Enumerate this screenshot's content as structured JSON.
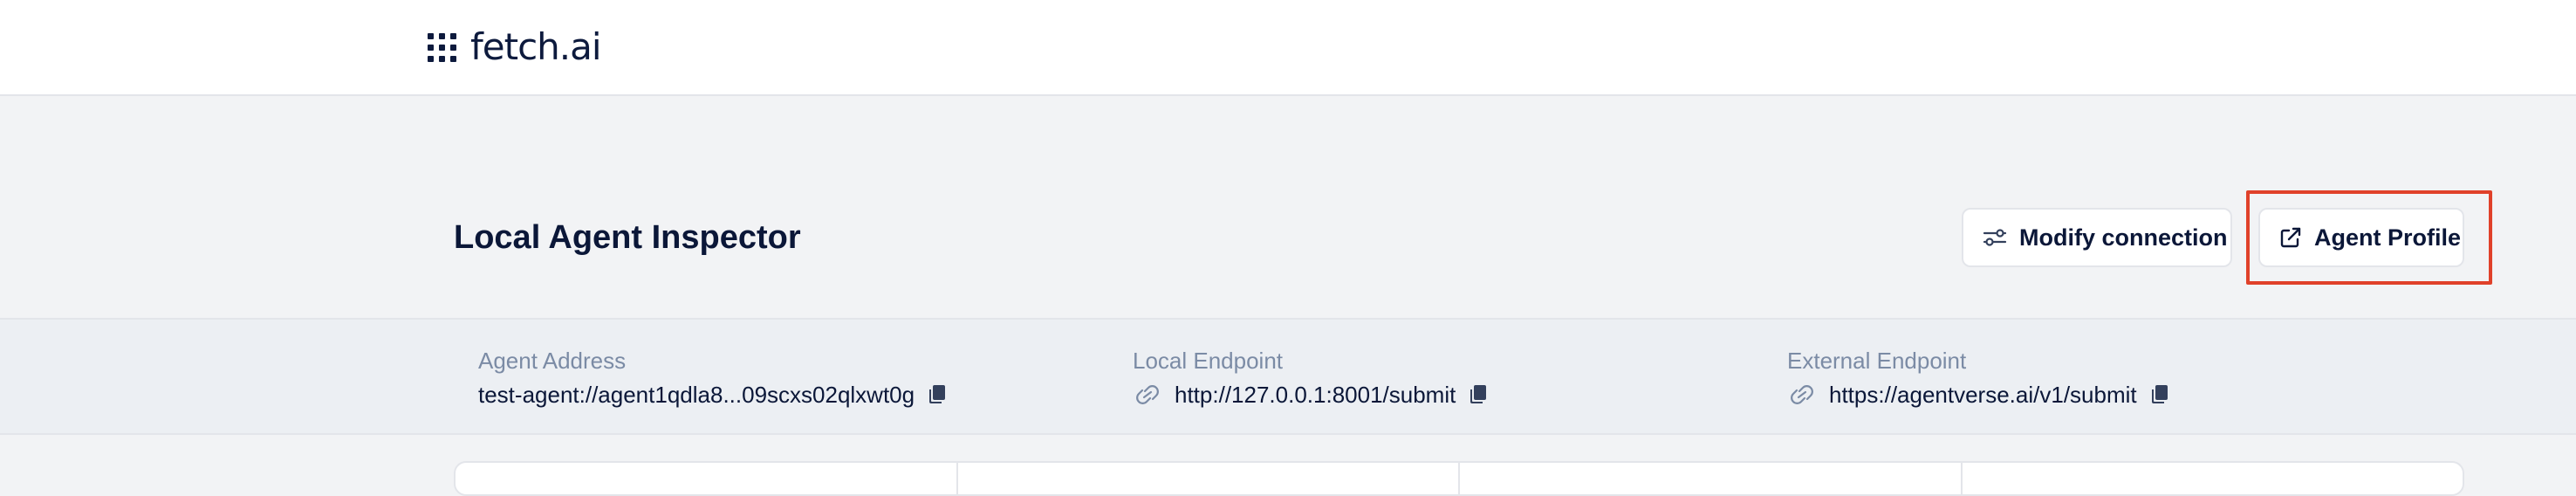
{
  "brand": {
    "name": "fetch.ai",
    "logo_icon": "grid-dots-icon"
  },
  "page": {
    "title": "Local Agent Inspector"
  },
  "actions": {
    "modify_connection": {
      "label": "Modify connection",
      "icon": "sliders-icon"
    },
    "agent_profile": {
      "label": "Agent Profile",
      "icon": "external-link-icon"
    }
  },
  "info": {
    "agent_address": {
      "label": "Agent Address",
      "value": "test-agent://agent1qdla8...09scxs02qlxwt0g"
    },
    "local_endpoint": {
      "label": "Local Endpoint",
      "value": "http://127.0.0.1:8001/submit"
    },
    "external_endpoint": {
      "label": "External Endpoint",
      "value": "https://agentverse.ai/v1/submit"
    }
  },
  "colors": {
    "highlight": "#e0412a",
    "text": "#0b1738",
    "muted": "#7b8ba5"
  }
}
